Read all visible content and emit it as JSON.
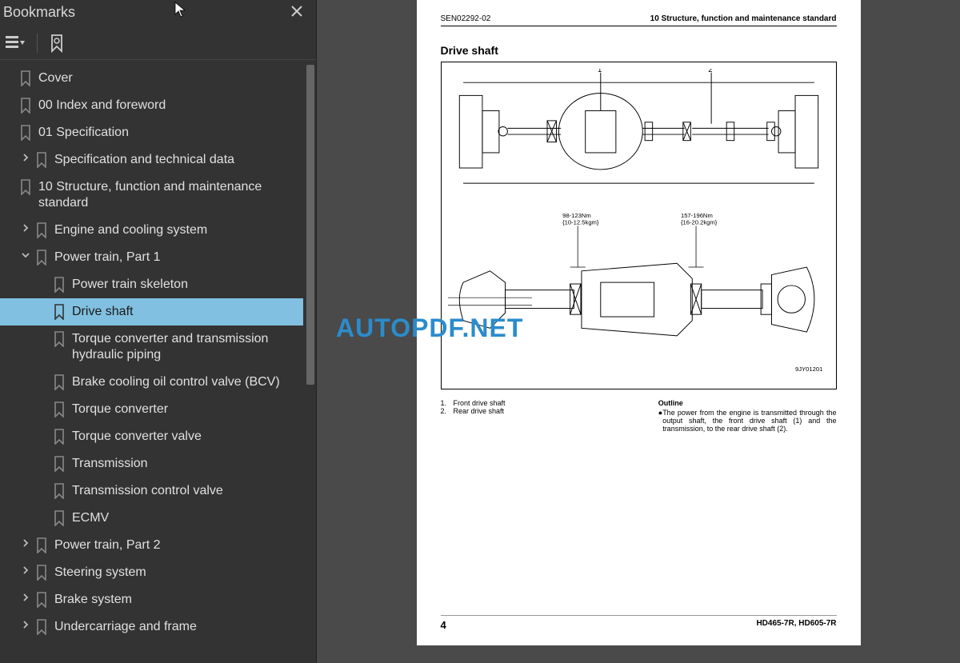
{
  "sidebar": {
    "title": "Bookmarks",
    "items": [
      {
        "label": "Cover",
        "level": 0,
        "exp": "",
        "sel": false,
        "leaf": true
      },
      {
        "label": "00 Index and foreword",
        "level": 0,
        "exp": "",
        "sel": false,
        "leaf": true
      },
      {
        "label": "01 Specification",
        "level": 0,
        "exp": "",
        "sel": false,
        "leaf": true
      },
      {
        "label": "Specification and technical data",
        "level": 1,
        "exp": "right",
        "sel": false
      },
      {
        "label": "10 Structure, function and maintenance standard",
        "level": 0,
        "exp": "",
        "sel": false,
        "leaf": true
      },
      {
        "label": "Engine and cooling system",
        "level": 1,
        "exp": "right",
        "sel": false
      },
      {
        "label": "Power train, Part 1",
        "level": 1,
        "exp": "down",
        "sel": false
      },
      {
        "label": "Power train skeleton",
        "level": 2,
        "exp": "",
        "sel": false,
        "leaf": true
      },
      {
        "label": "Drive shaft",
        "level": 2,
        "exp": "",
        "sel": true,
        "leaf": true
      },
      {
        "label": "Torque converter and transmission hydraulic piping",
        "level": 2,
        "exp": "",
        "sel": false,
        "leaf": true
      },
      {
        "label": "Brake cooling oil control valve (BCV)",
        "level": 2,
        "exp": "",
        "sel": false,
        "leaf": true
      },
      {
        "label": "Torque converter",
        "level": 2,
        "exp": "",
        "sel": false,
        "leaf": true
      },
      {
        "label": "Torque converter valve",
        "level": 2,
        "exp": "",
        "sel": false,
        "leaf": true
      },
      {
        "label": "Transmission",
        "level": 2,
        "exp": "",
        "sel": false,
        "leaf": true
      },
      {
        "label": "Transmission control valve",
        "level": 2,
        "exp": "",
        "sel": false,
        "leaf": true
      },
      {
        "label": "ECMV",
        "level": 2,
        "exp": "",
        "sel": false,
        "leaf": true
      },
      {
        "label": "Power train, Part 2",
        "level": 1,
        "exp": "right",
        "sel": false
      },
      {
        "label": "Steering system",
        "level": 1,
        "exp": "right",
        "sel": false
      },
      {
        "label": "Brake system",
        "level": 1,
        "exp": "right",
        "sel": false
      },
      {
        "label": "Undercarriage and frame",
        "level": 1,
        "exp": "right",
        "sel": false
      }
    ]
  },
  "page": {
    "header_left": "SEN02292-02",
    "header_right": "10 Structure, function and maintenance standard",
    "section_title": "Drive shaft",
    "torque1_a": "98-123Nm",
    "torque1_b": "{10-12.5kgm}",
    "torque2_a": "157-196Nm",
    "torque2_b": "{16-20.2kgm}",
    "callout_1": "1",
    "callout_2": "2",
    "dia_code": "9JY01201",
    "legend": {
      "n1": "1.",
      "l1": "Front drive shaft",
      "n2": "2.",
      "l2": "Rear drive shaft"
    },
    "outline_title": "Outline",
    "outline_bullet": "●",
    "outline_body": "The power from the engine is transmitted through the output shaft, the front drive shaft (1) and the transmission, to the rear drive shaft (2).",
    "footer_page": "4",
    "footer_model": "HD465-7R, HD605-7R"
  },
  "watermark": "AUTOPDF.NET"
}
